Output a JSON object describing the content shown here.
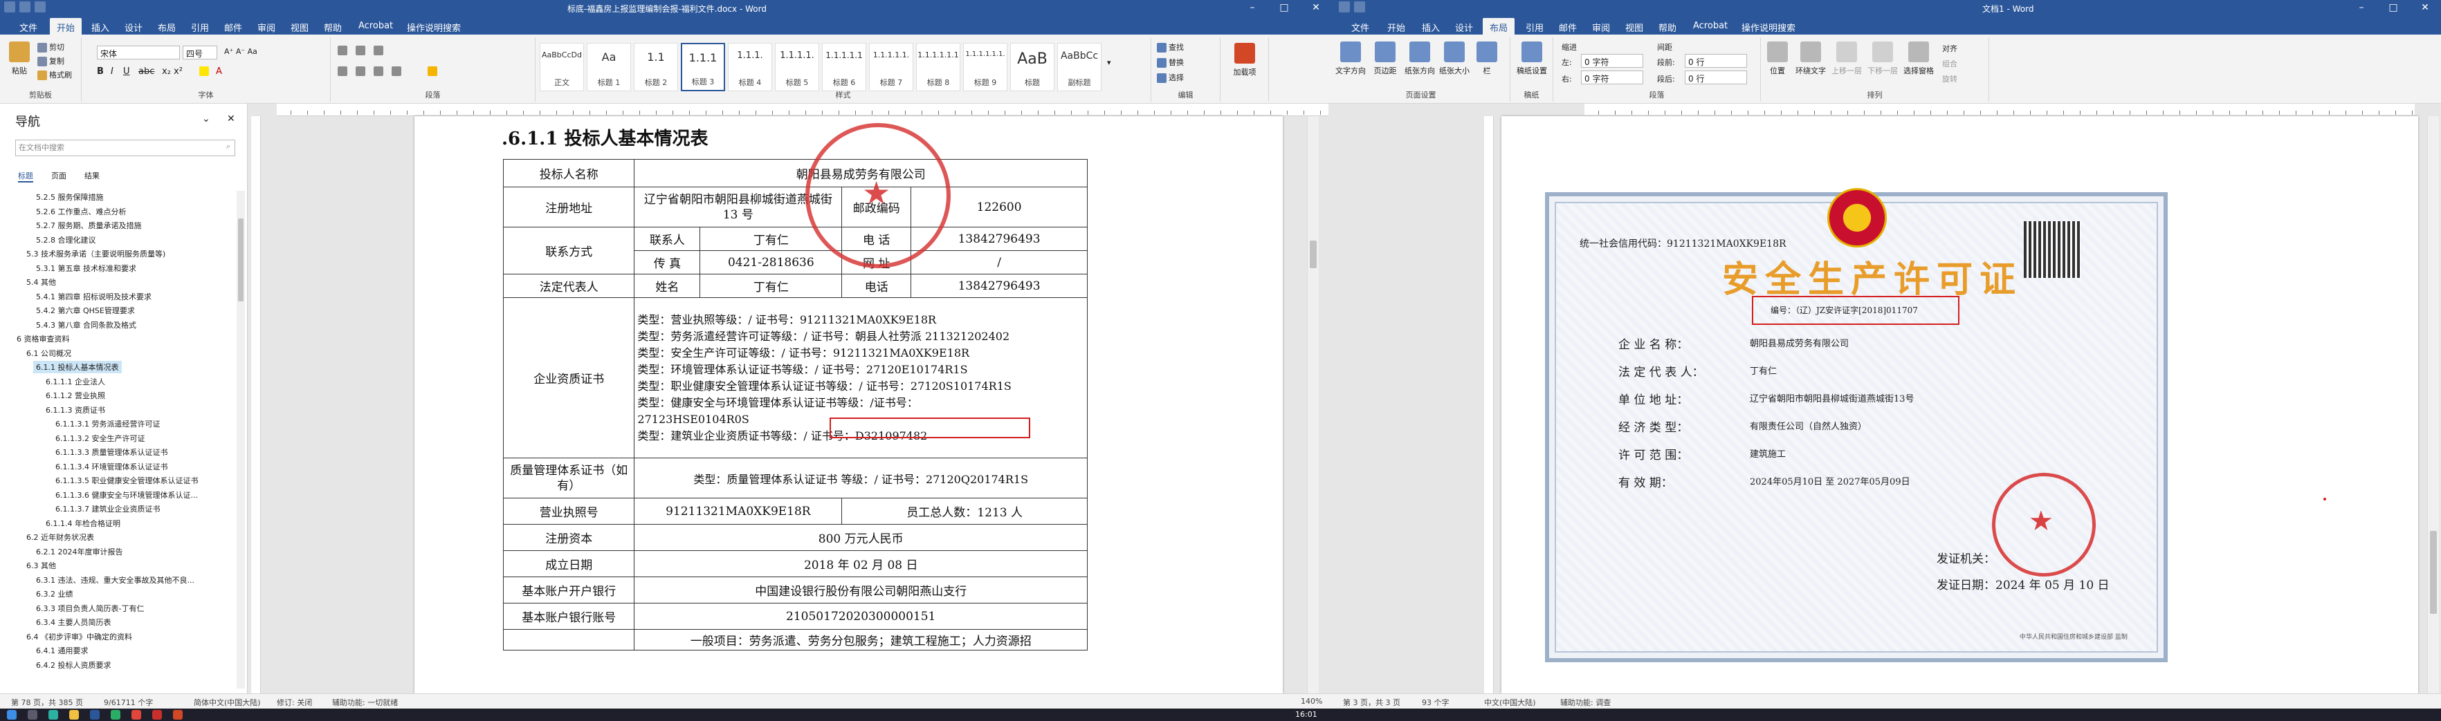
{
  "left_window": {
    "title": "标底-福鑫房上报监理编制会报-福利文件.docx - Word",
    "menu_tabs": [
      "文件",
      "开始",
      "插入",
      "设计",
      "布局",
      "引用",
      "邮件",
      "审阅",
      "视图",
      "帮助",
      "Acrobat",
      "操作说明搜索"
    ],
    "active_tab": "开始",
    "ribbon": {
      "clipboard": {
        "paste": "粘贴",
        "cut": "剪切",
        "copy": "复制",
        "format_painter": "格式刷",
        "label": "剪贴板"
      },
      "font": {
        "name": "宋体",
        "size": "四号",
        "label": "字体"
      },
      "paragraph": {
        "label": "段落"
      },
      "styles": {
        "label": "样式",
        "items": [
          {
            "sample": "AaBbCcDd",
            "name": "正文"
          },
          {
            "sample": "Aa",
            "name": "标题 1"
          },
          {
            "sample": "1.1",
            "name": "标题 2"
          },
          {
            "sample": "1.1.1",
            "name": "标题 3"
          },
          {
            "sample": "1.1.1.",
            "name": "标题 4"
          },
          {
            "sample": "1.1.1.1.",
            "name": "标题 5"
          },
          {
            "sample": "1.1.1.1.1",
            "name": "标题 6"
          },
          {
            "sample": "1.1.1.1.1.",
            "name": "标题 7"
          },
          {
            "sample": "1.1.1.1.1.1",
            "name": "标题 8"
          },
          {
            "sample": "1.1.1.1.1.1.",
            "name": "标题 9"
          },
          {
            "sample": "AaB",
            "name": "标题"
          },
          {
            "sample": "AaBbCc",
            "name": "副标题"
          }
        ]
      },
      "editing": {
        "find": "查找",
        "replace": "替换",
        "select": "选择",
        "label": "编辑"
      },
      "addin": {
        "name": "加载项"
      }
    },
    "nav": {
      "title": "导航",
      "search_placeholder": "在文档中搜索",
      "tabs": [
        "标题",
        "页面",
        "结果"
      ],
      "items": [
        "5.2.5 服务保障措施",
        "5.2.6 工作重点、难点分析",
        "5.2.7 服务期、质量承诺及措施",
        "5.2.8 合理化建议",
        "5.3 技术服务承诺（主要说明服务质量等)",
        "5.3.1 第五章 技术标准和要求",
        "5.4 其他",
        "5.4.1 第四章 招标说明及技术要求",
        "5.4.2 第六章 QHSE管理要求",
        "5.4.3 第八章 合同条款及格式",
        "6 资格审查资料",
        "6.1 公司概况",
        "6.1.1 投标人基本情况表",
        "6.1.1.1 企业法人",
        "6.1.1.2 营业执照",
        "6.1.1.3 资质证书",
        "6.1.1.3.1 劳务派遣经营许可证",
        "6.1.1.3.2 安全生产许可证",
        "6.1.1.3.3 质量管理体系认证证书",
        "6.1.1.3.4 环境管理体系认证证书",
        "6.1.1.3.5 职业健康安全管理体系认证证书",
        "6.1.1.3.6 健康安全与环境管理体系认证...",
        "6.1.1.3.7 建筑业企业资质证书",
        "6.1.1.4 年检合格证明",
        "6.2 近年财务状况表",
        "6.2.1 2024年度审计报告",
        "6.3 其他",
        "6.3.1 违法、违规、重大安全事故及其他不良...",
        "6.3.2 业绩",
        "6.3.3 项目负责人简历表-丁有仁",
        "6.3.4 主要人员简历表",
        "6.4 《初步评审》中确定的资料",
        "6.4.1 通用要求",
        "6.4.2 投标人资质要求"
      ],
      "selected_index": 12
    },
    "document": {
      "heading": ".6.1.1  投标人基本情况表",
      "rows": {
        "name_label": "投标人名称",
        "name_value": "朝阳县易成劳务有限公司",
        "addr_label": "注册地址",
        "addr_value": "辽宁省朝阳市朝阳县柳城街道燕城街 13 号",
        "postcode_label": "邮政编码",
        "postcode_value": "122600",
        "contact_label": "联系方式",
        "contact_person_label": "联系人",
        "contact_person_value": "丁有仁",
        "phone_label": "电    话",
        "phone_value": "13842796493",
        "fax_label": "传    真",
        "fax_value": "0421-2818636",
        "web_label": "网    址",
        "web_value": "/",
        "legal_label": "法定代表人",
        "legal_name_label": "姓名",
        "legal_name_value": "丁有仁",
        "legal_phone_label": "电话",
        "legal_phone_value": "13842796493",
        "qual_label": "企业资质证书",
        "qual_lines": [
          "类型：营业执照等级：/ 证书号：91211321MA0XK9E18R",
          "类型：劳务派遣经营许可证等级：/ 证书号：朝县人社劳派 211321202402",
          "类型：安全生产许可证等级：/ 证书号：91211321MA0XK9E18R",
          "类型：环境管理体系认证证书等级：/ 证书号：27120E10174R1S",
          "类型：职业健康安全管理体系认证证书等级：/ 证书号：27120S10174R1S",
          "类型：健康安全与环境管理体系认证证书等级：/证书号：",
          "27123HSE0104R0S",
          "类型：建筑业企业资质证书等级：/ 证书号：D321097482"
        ],
        "quality_label": "质量管理体系证书（如有）",
        "quality_value": "类型：质量管理体系认证证书 等级：/ 证书号：27120Q20174R1S",
        "license_label": "营业执照号",
        "license_value": "91211321MA0XK9E18R",
        "staff_label": "员工总人数：1213 人",
        "capital_label": "注册资本",
        "capital_value": "800 万元人民币",
        "founded_label": "成立日期",
        "founded_value": "2018 年 02 月 08 日",
        "bank_label": "基本账户开户银行",
        "bank_value": "中国建设银行股份有限公司朝阳燕山支行",
        "account_label": "基本账户银行账号",
        "account_value": "21050172020300000151",
        "scope_value": "一般项目：劳务派遣、劳务分包服务；建筑工程施工；人力资源招"
      }
    },
    "status": {
      "page": "第 78 页，共 385 页",
      "words": "9/61711 个字",
      "lang": "简体中文(中国大陆)",
      "track": "修订: 关闭",
      "access": "辅助功能: 一切就绪",
      "zoom": "140%"
    }
  },
  "right_window": {
    "title": "文档1 - Word",
    "menu_tabs": [
      "文件",
      "开始",
      "插入",
      "设计",
      "布局",
      "引用",
      "邮件",
      "审阅",
      "视图",
      "帮助",
      "Acrobat",
      "操作说明搜索"
    ],
    "active_tab": "布局",
    "ribbon": {
      "page_setup": {
        "items": [
          "文字方向",
          "页边距",
          "纸张方向",
          "纸张大小",
          "栏"
        ],
        "label": "页面设置"
      },
      "manuscript": {
        "name": "稿纸设置",
        "label": "稿纸"
      },
      "indent": {
        "title": "缩进",
        "left_label": "左:",
        "left_value": "0 字符",
        "right_label": "右:",
        "right_value": "0 字符"
      },
      "spacing": {
        "title": "间距",
        "before_label": "段前:",
        "before_value": "0 行",
        "after_label": "段后:",
        "after_value": "0 行"
      },
      "arrange": {
        "items": [
          "位置",
          "环绕文字",
          "上移一层",
          "下移一层",
          "选择窗格",
          "对齐",
          "组合",
          "旋转"
        ],
        "label": "排列"
      },
      "paragraph_label": "段落"
    },
    "certificate": {
      "credit_code": "统一社会信用代码：91211321MA0XK9E18R",
      "title": "安全生产许可证",
      "number": "编号：（辽）JZ安许证字[2018]011707",
      "fields": [
        {
          "label": "企 业 名 称：",
          "value": "朝阳县易成劳务有限公司"
        },
        {
          "label": "法 定 代 表 人：",
          "value": "丁有仁"
        },
        {
          "label": "单 位 地 址：",
          "value": "辽宁省朝阳市朝阳县柳城街道燕城街13号"
        },
        {
          "label": "经 济 类 型：",
          "value": "有限责任公司（自然人独资）"
        },
        {
          "label": "许 可 范 围：",
          "value": "建筑施工"
        },
        {
          "label": "有     效     期：",
          "value": "2024年05月10日    至    2027年05月09日"
        }
      ],
      "issuer": "发证机关：",
      "issue_date": "发证日期：2024 年 05 月 10 日",
      "footer": "中华人民共和国住房和城乡建设部 监制"
    },
    "status": {
      "page": "第 3 页，共 3 页",
      "words": "93 个字",
      "lang": "中文(中国大陆)",
      "access": "辅助功能: 调查"
    }
  },
  "taskbar": {
    "time": "16:01"
  }
}
